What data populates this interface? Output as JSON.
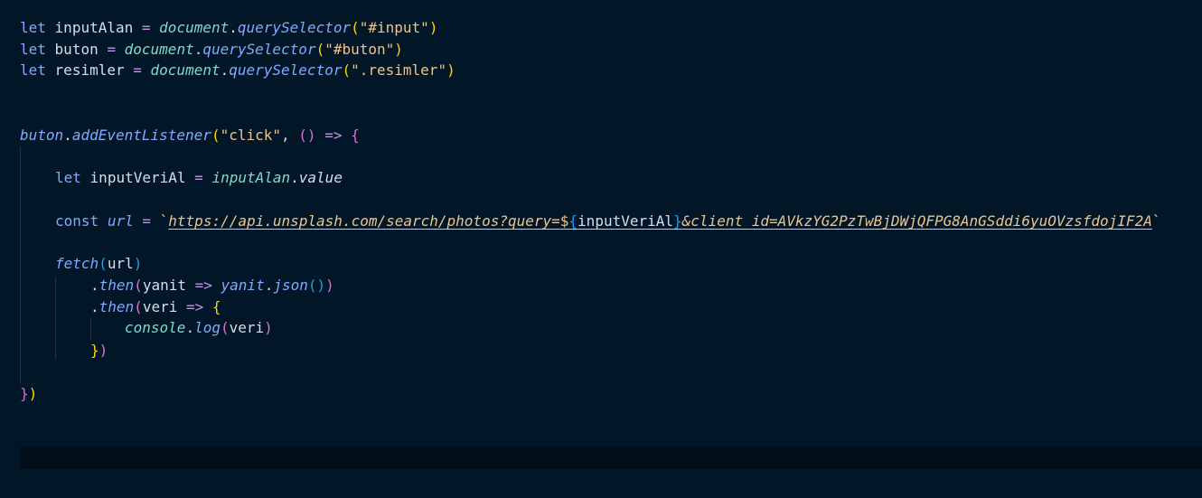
{
  "editor": {
    "lines": {
      "l1": {
        "kw": "let",
        "name": "inputAlan",
        "op": "=",
        "obj": "document",
        "dot": ".",
        "fn": "querySelector",
        "open": "(",
        "str": "\"#input\"",
        "close": ")"
      },
      "l2": {
        "kw": "let",
        "name": "buton",
        "op": "=",
        "obj": "document",
        "dot": ".",
        "fn": "querySelector",
        "open": "(",
        "str": "\"#buton\"",
        "close": ")"
      },
      "l3": {
        "kw": "let",
        "name": "resimler",
        "op": "=",
        "obj": "document",
        "dot": ".",
        "fn": "querySelector",
        "open": "(",
        "str": "\".resimler\"",
        "close": ")"
      },
      "l4": {
        "obj": "buton",
        "dot": ".",
        "fn": "addEventListener",
        "open": "(",
        "str": "\"click\"",
        "comma": ",",
        "args": "()",
        "arrow": "=>",
        "brace": "{"
      },
      "l5": {
        "kw": "let",
        "name": "inputVeriAl",
        "op": "=",
        "obj": "inputAlan",
        "dot": ".",
        "prop": "value"
      },
      "l6": {
        "kw": "const",
        "name": "url",
        "op": "=",
        "tick_open": "`",
        "tpl_start": "https://api.unsplash.com/search/photos?query=",
        "dollar": "$",
        "brace_open": "{",
        "expr": "inputVeriAl",
        "brace_close": "}",
        "tpl_end": "&client_id=AVkzYG2PzTwBjDWjQFPG8AnGSddi6yuOVzsfdojIF2A",
        "tick_close": "`"
      },
      "l7": {
        "fn": "fetch",
        "open": "(",
        "arg": "url",
        "close": ")"
      },
      "l8": {
        "dot": ".",
        "fn": "then",
        "open": "(",
        "param": "yanit",
        "arrow": "=>",
        "obj": "yanit",
        "dot2": ".",
        "fn2": "json",
        "call": "()",
        "close": ")"
      },
      "l9": {
        "dot": ".",
        "fn": "then",
        "open": "(",
        "param": "veri",
        "arrow": "=>",
        "brace": "{"
      },
      "l10": {
        "obj": "console",
        "dot": ".",
        "fn": "log",
        "open": "(",
        "arg": "veri",
        "close": ")"
      },
      "l11": {
        "brace": "}",
        "close": ")"
      },
      "l12": {
        "brace": "}",
        "close": ")"
      }
    }
  },
  "colors": {
    "background": "#011627",
    "keyword": "#c792ea",
    "function": "#82aaff",
    "object": "#7fdbca",
    "string": "#ecc48d",
    "bracket_gold": "#ffd700",
    "bracket_orchid": "#da70d6",
    "bracket_blue": "#179fff"
  }
}
